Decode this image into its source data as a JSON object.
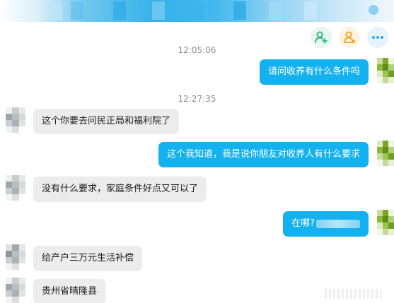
{
  "timestamps": {
    "first": "12:05:06",
    "second": "12:27:35"
  },
  "toolbar": {
    "icons": [
      "add-friend-icon",
      "contact-card-icon",
      "more-icon"
    ]
  },
  "messages": [
    {
      "side": "right",
      "text": "请问收养有什么条件吗"
    },
    {
      "side": "left",
      "text": "这个你要去问民正局和福利院了"
    },
    {
      "side": "right",
      "text": "这个我知道，我是说你朋友对收养人有什么要求"
    },
    {
      "side": "left",
      "text": "没有什么要求，家庭条件好点又可以了"
    },
    {
      "side": "right",
      "text": "在哪?"
    },
    {
      "side": "left",
      "text": "给产户三万元生活补偿"
    },
    {
      "side": "left",
      "text": "贵州省晴隆县"
    }
  ],
  "colors": {
    "sent_bubble": "#14b1ef",
    "received_bubble": "#ececec",
    "header_accent": "#34b1ea"
  }
}
